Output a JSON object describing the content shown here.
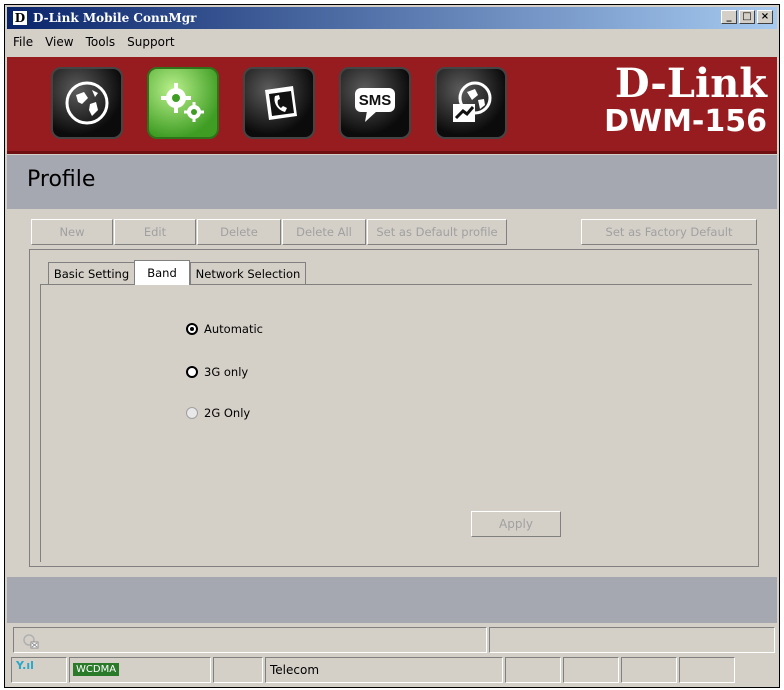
{
  "window": {
    "title": "D-Link Mobile ConnMgr",
    "app_icon": "D",
    "controls": [
      "minimize-icon",
      "maximize-icon",
      "close-icon"
    ]
  },
  "menu": [
    "File",
    "View",
    "Tools",
    "Support"
  ],
  "banner": {
    "icons": [
      {
        "name": "internet-globe-icon",
        "active": false
      },
      {
        "name": "settings-gears-icon",
        "active": true
      },
      {
        "name": "phonebook-icon",
        "active": false
      },
      {
        "name": "sms-icon",
        "label": "SMS",
        "active": false
      },
      {
        "name": "statistics-globe-icon",
        "active": false
      }
    ],
    "brand": "D-Link",
    "model": "DWM-156",
    "color": "#971c20"
  },
  "profile": {
    "title": "Profile"
  },
  "toolbar": {
    "new": "New",
    "edit": "Edit",
    "delete": "Delete",
    "delete_all": "Delete All",
    "set_default": "Set as Default profile",
    "factory_default": "Set as Factory Default"
  },
  "tabs": [
    "Basic Setting",
    "Band",
    "Network Selection"
  ],
  "selected_tab": "Band",
  "band": {
    "automatic": "Automatic",
    "only3g": "3G only",
    "only2g": "2G Only",
    "selected": "Automatic"
  },
  "apply_label": "Apply",
  "status": {
    "network_type": "WCDMA",
    "operator": "Telecom"
  }
}
